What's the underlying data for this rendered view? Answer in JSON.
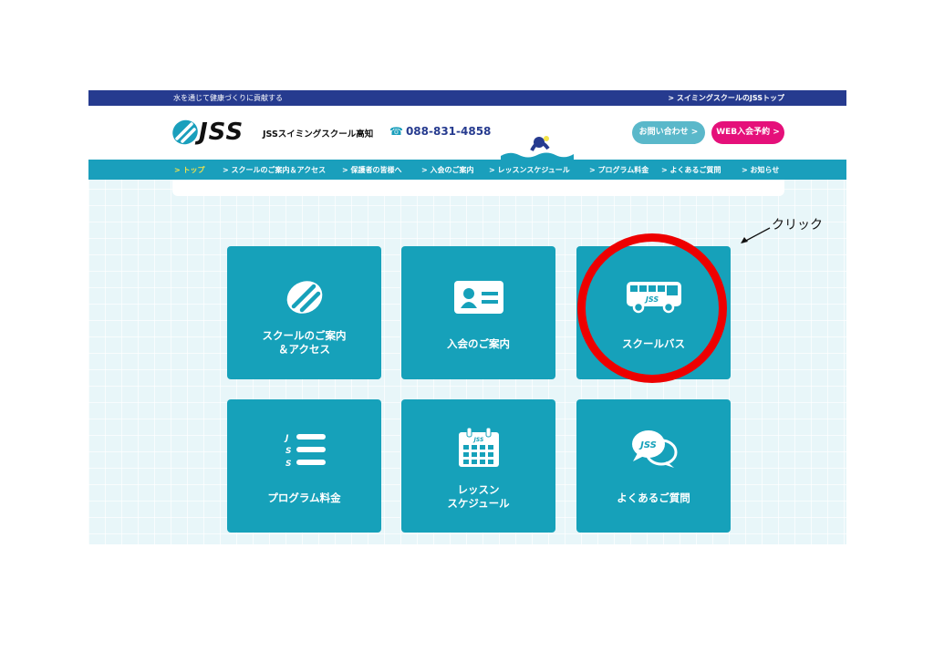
{
  "topbar": {
    "tagline": "水を通じて健康づくりに貢献する",
    "link": "> スイミングスクールのJSSトップ"
  },
  "header": {
    "logo_text": "JSS",
    "school_name": "JSSスイミングスクール高知",
    "phone": "088-831-4858",
    "contact_button": "お問い合わせ >",
    "web_button": "WEB入会予約 >"
  },
  "nav": {
    "items": [
      "> トップ",
      "> スクールのご案内＆アクセス",
      "> 保護者の皆様へ",
      "> 入会のご案内",
      "> レッスンスケジュール",
      "> プログラム料金",
      "> よくあるご質問",
      "> お知らせ"
    ]
  },
  "cards": [
    {
      "label": "スクールのご案内\n＆アクセス"
    },
    {
      "label": "入会のご案内"
    },
    {
      "label": "スクールバス"
    },
    {
      "label": "プログラム料金"
    },
    {
      "label": "レッスン\nスケジュール"
    },
    {
      "label": "よくあるご質問"
    }
  ],
  "icon_text": {
    "bus": "JSS",
    "calendar": "JSS",
    "chat": "JSS",
    "list_letters": [
      "J",
      "S",
      "S"
    ]
  },
  "annotation": {
    "label": "クリック"
  },
  "colors": {
    "navy": "#263b8f",
    "teal": "#1a9fbc",
    "card": "#16a1ba",
    "pink": "#e5107a",
    "annotation_red": "#ee0000",
    "active_nav": "#f3e34a"
  },
  "icons": [
    "phone-icon",
    "swim-logo-icon",
    "card-id-icon",
    "bus-icon",
    "list-icon",
    "calendar-icon",
    "chat-icon"
  ]
}
